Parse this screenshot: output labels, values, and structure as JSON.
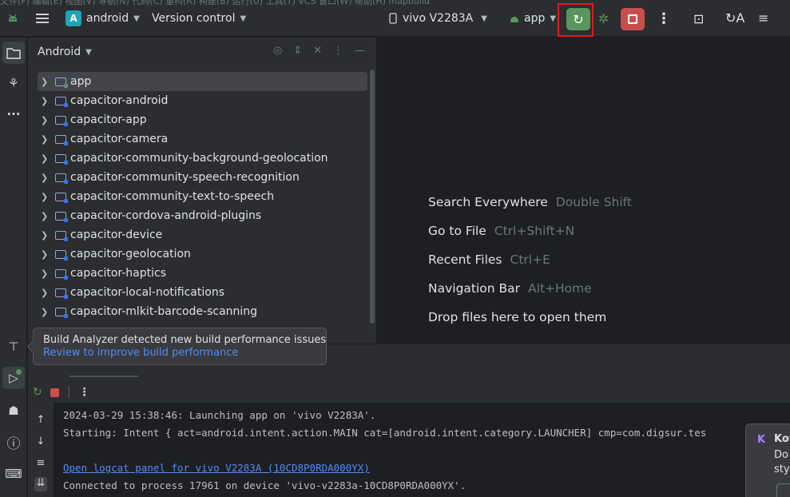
{
  "titlebar": {
    "ghost_tabs": "文件(F)  编辑(E)  视图(V)  导航(N)  代码(C)  重构(R)  构建(B)  运行(U)  工具(T)  VCS  窗口(W)  帮助(H)  mapbuild",
    "project_badge": "A",
    "project_name": "android",
    "vcs_label": "Version control",
    "device_label": "vivo V2283A",
    "run_config": "app"
  },
  "project_panel": {
    "title": "Android",
    "items": [
      {
        "label": "app"
      },
      {
        "label": "capacitor-android"
      },
      {
        "label": "capacitor-app"
      },
      {
        "label": "capacitor-camera"
      },
      {
        "label": "capacitor-community-background-geolocation"
      },
      {
        "label": "capacitor-community-speech-recognition"
      },
      {
        "label": "capacitor-community-text-to-speech"
      },
      {
        "label": "capacitor-cordova-android-plugins"
      },
      {
        "label": "capacitor-device"
      },
      {
        "label": "capacitor-geolocation"
      },
      {
        "label": "capacitor-haptics"
      },
      {
        "label": "capacitor-local-notifications"
      },
      {
        "label": "capacitor-mlkit-barcode-scanning"
      }
    ]
  },
  "editor_hints": [
    {
      "action": "Search Everywhere",
      "shortcut": "Double Shift"
    },
    {
      "action": "Go to File",
      "shortcut": "Ctrl+Shift+N"
    },
    {
      "action": "Recent Files",
      "shortcut": "Ctrl+E"
    },
    {
      "action": "Navigation Bar",
      "shortcut": "Alt+Home"
    },
    {
      "action": "Drop files here to open them",
      "shortcut": ""
    }
  ],
  "tooltip": {
    "message": "Build Analyzer detected new build performance issues",
    "link": "Review to improve build performance"
  },
  "console": {
    "lines": [
      "2024-03-29 15:38:46: Launching app on 'vivo V2283A'.",
      "Starting: Intent { act=android.intent.action.MAIN cat=[android.intent.category.LAUNCHER] cmp=com.digsur.tes",
      "",
      "Open logcat panel for vivo V2283A (10CD8P0RDA000YX)",
      "Connected to process 17961 on device 'vivo-v2283a-10CD8P0RDA000YX'."
    ]
  },
  "notification": {
    "title": "Kot",
    "body_1": "Do",
    "body_2": "sty"
  },
  "colors": {
    "run_green": "#57965c",
    "stop_red": "#c94f4f",
    "highlight_red": "#e01b1b",
    "link_blue": "#548af7"
  }
}
